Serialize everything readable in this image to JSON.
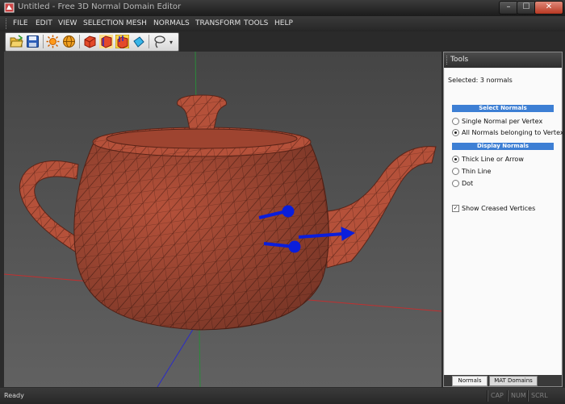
{
  "window": {
    "title": "Untitled - Free 3D Normal Domain Editor",
    "controls": {
      "minimize": "–",
      "maximize": "☐",
      "close": "✕"
    }
  },
  "menu": [
    "FILE",
    "EDIT",
    "VIEW",
    "SELECTION",
    "MESH",
    "NORMALS",
    "TRANSFORM",
    "TOOLS",
    "HELP"
  ],
  "toolbar": {
    "icons": [
      "open-folder-icon",
      "save-disk-icon",
      "light-burst-icon",
      "globe-icon",
      "box-icon",
      "select-faces-icon",
      "select-normals-icon",
      "select-vertices-icon",
      "lasso-icon",
      "dropdown-arrow-icon"
    ],
    "overflow_glyph": "▾"
  },
  "tools_panel": {
    "title": "Tools",
    "selected_text": "Selected: 3 normals",
    "select_normals": {
      "header": "Select Normals",
      "options": [
        {
          "label": "Single Normal per Vertex",
          "checked": false
        },
        {
          "label": "All Normals belonging to Vertex",
          "checked": true
        }
      ]
    },
    "display_normals": {
      "header": "Display Normals",
      "options": [
        {
          "label": "Thick Line or Arrow",
          "checked": true
        },
        {
          "label": "Thin Line",
          "checked": false
        },
        {
          "label": "Dot",
          "checked": false
        }
      ]
    },
    "show_creased": {
      "label": "Show Creased Vertices",
      "checked": true,
      "mark": "✓"
    },
    "tabs": [
      {
        "label": "Normals",
        "active": true
      },
      {
        "label": "MAT Domains",
        "active": false
      }
    ]
  },
  "status_bar": {
    "text": "Ready",
    "indicators": [
      "CAP",
      "NUM",
      "SCRL"
    ]
  },
  "colors": {
    "accent_blue": "#3d7fd4",
    "teapot": "#b5513a",
    "normal_arrows": "#0a1edc",
    "axis_red": "#c03030",
    "axis_green": "#2a8a3a",
    "axis_blue": "#2a2ac8"
  }
}
